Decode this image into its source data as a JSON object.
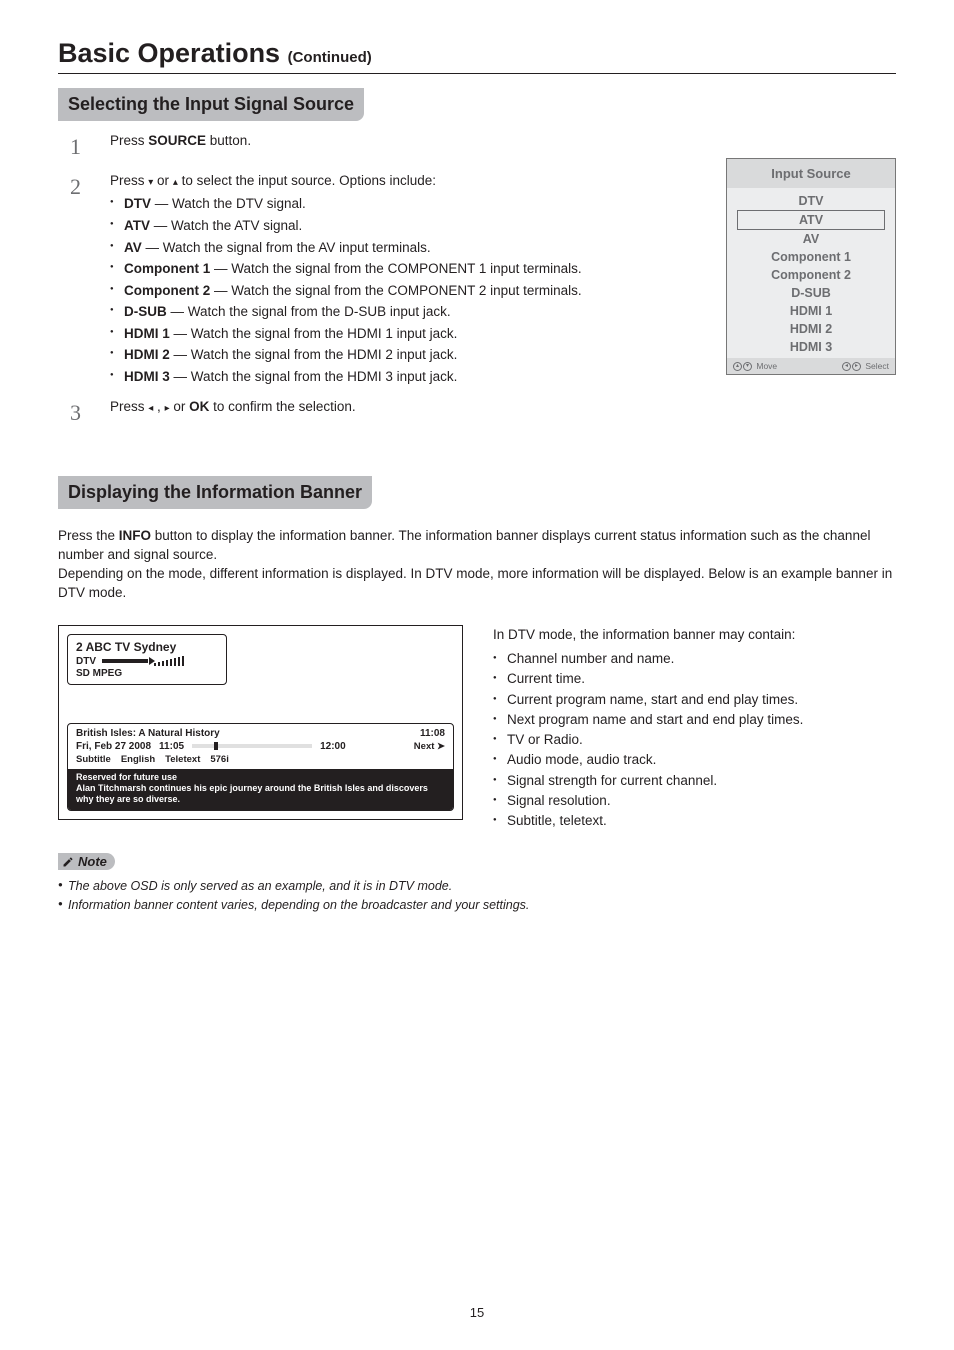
{
  "page": {
    "title": "Basic Operations",
    "continued": "(Continued)",
    "number": "15"
  },
  "section1": {
    "heading": "Selecting the Input Signal Source",
    "step1": {
      "num": "1",
      "pre": "Press ",
      "bold": "SOURCE",
      "post": " button."
    },
    "step2": {
      "num": "2",
      "lead_pre": "Press ",
      "lead_mid": " or ",
      "lead_post": " to select the input source. Options include:",
      "items": [
        {
          "name": "DTV",
          "desc": " — Watch the DTV signal."
        },
        {
          "name": "ATV",
          "desc": " — Watch the ATV signal."
        },
        {
          "name": "AV",
          "desc": " — Watch the signal from the AV input terminals."
        },
        {
          "name": "Component 1",
          "desc": " — Watch the signal from the COMPONENT 1 input terminals."
        },
        {
          "name": "Component 2",
          "desc": " — Watch the signal from the COMPONENT 2 input terminals."
        },
        {
          "name": "D-SUB",
          "desc": " — Watch the signal from the D-SUB input jack."
        },
        {
          "name": "HDMI 1",
          "desc": " — Watch the signal from the HDMI 1 input jack."
        },
        {
          "name": "HDMI 2",
          "desc": " — Watch the signal from the HDMI 2 input jack."
        },
        {
          "name": "HDMI 3",
          "desc": " — Watch the signal from the HDMI 3 input jack."
        }
      ]
    },
    "step3": {
      "num": "3",
      "pre": "Press  ",
      "mid": " ,  ",
      "ok": "OK",
      "or": " or ",
      "post": " to confirm the selection."
    }
  },
  "inputSource": {
    "title": "Input Source",
    "items": [
      "DTV",
      "ATV",
      "AV",
      "Component 1",
      "Component 2",
      "D-SUB",
      "HDMI 1",
      "HDMI 2",
      "HDMI 3"
    ],
    "footMove": "Move",
    "footSelect": "Select"
  },
  "section2": {
    "heading": "Displaying the Information Banner",
    "para_pre": "Press the ",
    "para_bold": "INFO",
    "para_post": " button to display the information banner. The information banner displays current status information such as the channel number and signal source.\nDepending on the mode, different information is displayed. In DTV mode, more information will be displayed. Below is an example banner in DTV mode."
  },
  "banner": {
    "ch": "2  ABC TV Sydney",
    "dtv": "DTV",
    "sdmpeg": "SD MPEG",
    "prog_title": "British Isles: A Natural History",
    "end_time": "11:08",
    "date": "Fri, Feb 27 2008",
    "start_time": "11:05",
    "dur_end": "12:00",
    "next": "Next ➤",
    "tags": {
      "subtitle": "Subtitle",
      "english": "English",
      "teletext": "Teletext",
      "res": "576i"
    },
    "dark1": "Reserved for future use",
    "dark2": "Alan Titchmarsh continues his epic journey around the British Isles and discovers why they are so diverse."
  },
  "rightList": {
    "lead": "In DTV mode, the information banner may contain:",
    "items": [
      "Channel number and name.",
      "Current time.",
      "Current program name, start and end play times.",
      "Next program name and start and end play times.",
      "TV or Radio.",
      "Audio mode, audio track.",
      "Signal strength for current channel.",
      "Signal resolution.",
      "Subtitle, teletext."
    ]
  },
  "note": {
    "tag": "Note",
    "lines": [
      "The above OSD is only served as an example, and it is in DTV mode.",
      "Information banner content varies, depending on the broadcaster and your settings."
    ]
  }
}
